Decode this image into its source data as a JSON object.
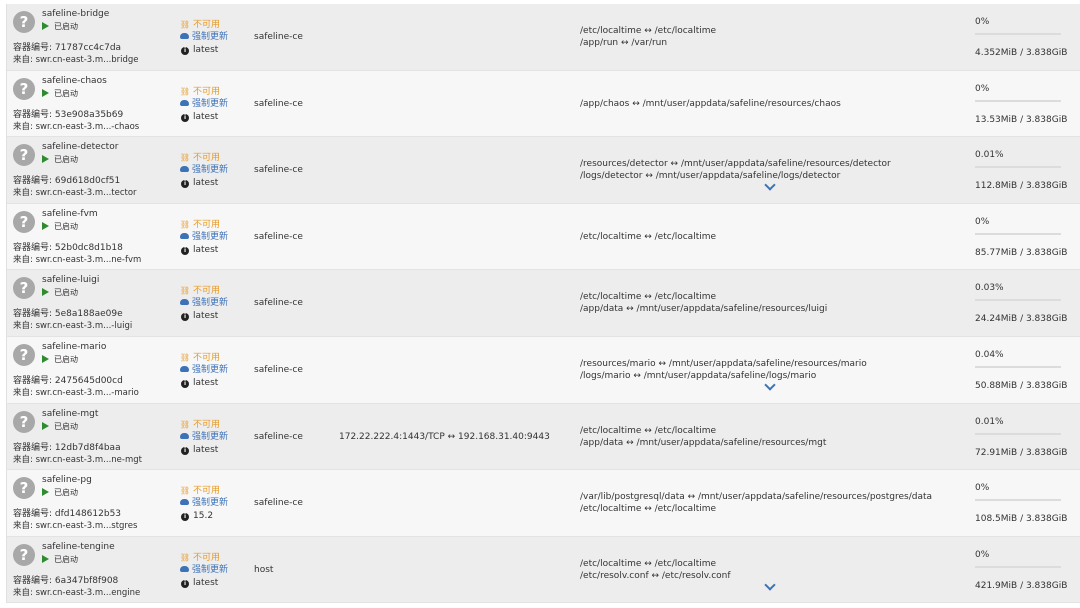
{
  "labels": {
    "not_available": "不可用",
    "force_update": "强制更新",
    "id_prefix": "容器编号: ",
    "src_prefix": "来自: "
  },
  "colors": {
    "not_available": "#e89a26",
    "force_update": "#3d72b7",
    "running": "#2e8b2e"
  },
  "containers": [
    {
      "name": "safeline-bridge",
      "state": "已启动",
      "id": "71787cc4c7da",
      "source": "swr.cn-east-3.m...bridge",
      "tag": "latest",
      "network": "safeline-ce",
      "ports": "",
      "volumes": [
        "/etc/localtime ↔ /etc/localtime",
        "/app/run ↔ /var/run"
      ],
      "expand": false,
      "cpu": "0%",
      "cpu_value": 0,
      "mem": "4.352MiB / 3.838GiB"
    },
    {
      "name": "safeline-chaos",
      "state": "已启动",
      "id": "53e908a35b69",
      "source": "swr.cn-east-3.m...-chaos",
      "tag": "latest",
      "network": "safeline-ce",
      "ports": "",
      "volumes": [
        "/app/chaos ↔ /mnt/user/appdata/safeline/resources/chaos"
      ],
      "expand": false,
      "cpu": "0%",
      "cpu_value": 0,
      "mem": "13.53MiB / 3.838GiB"
    },
    {
      "name": "safeline-detector",
      "state": "已启动",
      "id": "69d618d0cf51",
      "source": "swr.cn-east-3.m...tector",
      "tag": "latest",
      "network": "safeline-ce",
      "ports": "",
      "volumes": [
        "/resources/detector ↔ /mnt/user/appdata/safeline/resources/detector",
        "/logs/detector ↔ /mnt/user/appdata/safeline/logs/detector"
      ],
      "expand": true,
      "cpu": "0.01%",
      "cpu_value": 0.01,
      "mem": "112.8MiB / 3.838GiB"
    },
    {
      "name": "safeline-fvm",
      "state": "已启动",
      "id": "52b0dc8d1b18",
      "source": "swr.cn-east-3.m...ne-fvm",
      "tag": "latest",
      "network": "safeline-ce",
      "ports": "",
      "volumes": [
        "/etc/localtime ↔ /etc/localtime"
      ],
      "expand": false,
      "cpu": "0%",
      "cpu_value": 0,
      "mem": "85.77MiB / 3.838GiB"
    },
    {
      "name": "safeline-luigi",
      "state": "已启动",
      "id": "5e8a188ae09e",
      "source": "swr.cn-east-3.m...-luigi",
      "tag": "latest",
      "network": "safeline-ce",
      "ports": "",
      "volumes": [
        "/etc/localtime ↔ /etc/localtime",
        "/app/data ↔ /mnt/user/appdata/safeline/resources/luigi"
      ],
      "expand": false,
      "cpu": "0.03%",
      "cpu_value": 0.03,
      "mem": "24.24MiB / 3.838GiB"
    },
    {
      "name": "safeline-mario",
      "state": "已启动",
      "id": "2475645d00cd",
      "source": "swr.cn-east-3.m...-mario",
      "tag": "latest",
      "network": "safeline-ce",
      "ports": "",
      "volumes": [
        "/resources/mario ↔ /mnt/user/appdata/safeline/resources/mario",
        "/logs/mario ↔ /mnt/user/appdata/safeline/logs/mario"
      ],
      "expand": true,
      "cpu": "0.04%",
      "cpu_value": 0.04,
      "mem": "50.88MiB / 3.838GiB"
    },
    {
      "name": "safeline-mgt",
      "state": "已启动",
      "id": "12db7d8f4baa",
      "source": "swr.cn-east-3.m...ne-mgt",
      "tag": "latest",
      "network": "safeline-ce",
      "ports": "172.22.222.4:1443/TCP ↔ 192.168.31.40:9443",
      "volumes": [
        "/etc/localtime ↔ /etc/localtime",
        "/app/data ↔ /mnt/user/appdata/safeline/resources/mgt"
      ],
      "expand": false,
      "cpu": "0.01%",
      "cpu_value": 0.01,
      "mem": "72.91MiB / 3.838GiB"
    },
    {
      "name": "safeline-pg",
      "state": "已启动",
      "id": "dfd148612b53",
      "source": "swr.cn-east-3.m...stgres",
      "tag": "15.2",
      "network": "safeline-ce",
      "ports": "",
      "volumes": [
        "/var/lib/postgresql/data ↔ /mnt/user/appdata/safeline/resources/postgres/data",
        "/etc/localtime ↔ /etc/localtime"
      ],
      "expand": false,
      "cpu": "0%",
      "cpu_value": 0,
      "mem": "108.5MiB / 3.838GiB"
    },
    {
      "name": "safeline-tengine",
      "state": "已启动",
      "id": "6a347bf8f908",
      "source": "swr.cn-east-3.m...engine",
      "tag": "latest",
      "network": "host",
      "ports": "",
      "volumes": [
        "/etc/localtime ↔ /etc/localtime",
        "/etc/resolv.conf ↔ /etc/resolv.conf"
      ],
      "expand": true,
      "cpu": "0%",
      "cpu_value": 0,
      "mem": "421.9MiB / 3.838GiB"
    }
  ]
}
